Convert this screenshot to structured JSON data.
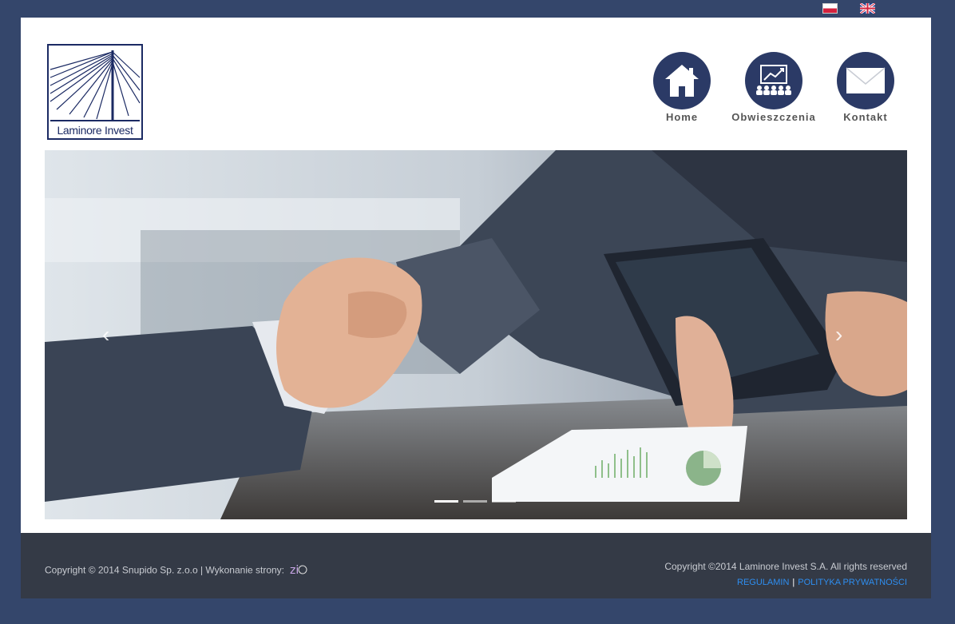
{
  "flags": {
    "pl": {
      "icon": "poland-flag-icon"
    },
    "en": {
      "icon": "uk-flag-icon"
    }
  },
  "logo": {
    "text": "Laminore Invest",
    "icon": "bridge-logo-icon",
    "color": "#1b2a63"
  },
  "nav": {
    "items": [
      {
        "label": "Home",
        "icon": "house-icon"
      },
      {
        "label": "Obwieszczenia",
        "icon": "presentation-chart-icon"
      },
      {
        "label": "Kontakt",
        "icon": "envelope-icon"
      }
    ]
  },
  "slider": {
    "image": "handshake-business-photo",
    "prev_icon": "‹",
    "next_icon": "›",
    "slides_count": 3,
    "active_slide": 1
  },
  "footer": {
    "left_text": "Copyright © 2014 Snupido Sp. z.o.o | Wykonanie strony:",
    "right_text": "Copyright ©2014 Laminore Invest S.A. All rights reserved",
    "links": {
      "terms": "REGULAMIN",
      "separator": "|",
      "privacy": "POLITYKA PRYWATNOŚCI"
    }
  },
  "colors": {
    "background": "#34466b",
    "nav_circle": "#2b3a66",
    "footer_bg": "#343a46",
    "link": "#2e8ef0"
  }
}
